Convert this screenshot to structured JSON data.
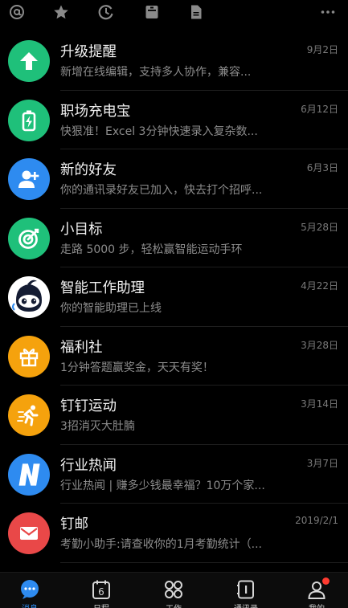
{
  "top_icons": [
    "at-icon",
    "star-icon",
    "history-icon",
    "archive-icon",
    "document-icon",
    "more-icon"
  ],
  "items": [
    {
      "title": "升级提醒",
      "subtitle": "新增在线编辑，支持多人协作，兼容...",
      "time": "9月2日",
      "icon": "arrow-up-icon",
      "color": "#1fc07a"
    },
    {
      "title": "职场充电宝",
      "subtitle": "快狠准！Excel 3分钟快速录入复杂数...",
      "time": "6月12日",
      "icon": "battery-icon",
      "color": "#1fc07a"
    },
    {
      "title": "新的好友",
      "subtitle": "你的通讯录好友已加入，快去打个招呼...",
      "time": "6月3日",
      "icon": "add-friend-icon",
      "color": "#2e8bf0"
    },
    {
      "title": "小目标",
      "subtitle": "走路 5000 步，轻松赢智能运动手环",
      "time": "5月28日",
      "icon": "target-icon",
      "color": "#1fc07a"
    },
    {
      "title": "智能工作助理",
      "subtitle": "你的智能助理已上线",
      "time": "4月22日",
      "icon": "robot-avatar",
      "color": "#ffffff"
    },
    {
      "title": "福利社",
      "subtitle": "1分钟答题赢奖金，天天有奖！",
      "time": "3月28日",
      "icon": "gift-icon",
      "color": "#f5a20d"
    },
    {
      "title": "钉钉运动",
      "subtitle": "3招消灭大肚腩",
      "time": "3月14日",
      "icon": "running-icon",
      "color": "#f5a20d"
    },
    {
      "title": "行业热闻",
      "subtitle": "行业热闻 | 赚多少钱最幸福？10万个家...",
      "time": "3月7日",
      "icon": "news-n-icon",
      "color": "#2e8bf0"
    },
    {
      "title": "钉邮",
      "subtitle": "考勤小助手:请查收你的1月考勤统计（...",
      "time": "2019/2/1",
      "icon": "mail-icon",
      "color": "#e94848"
    }
  ],
  "tabs": [
    {
      "label": "消息",
      "icon": "message-icon",
      "active": true
    },
    {
      "label": "日程",
      "icon": "calendar-icon",
      "active": false,
      "calendar_day": "6"
    },
    {
      "label": "工作",
      "icon": "work-grid-icon",
      "active": false
    },
    {
      "label": "通讯录",
      "icon": "contacts-icon",
      "active": false
    },
    {
      "label": "我的",
      "icon": "profile-icon",
      "active": false,
      "badge": true
    }
  ],
  "colors": {
    "accent": "#2e8bf0",
    "badge": "#ff3b30"
  }
}
